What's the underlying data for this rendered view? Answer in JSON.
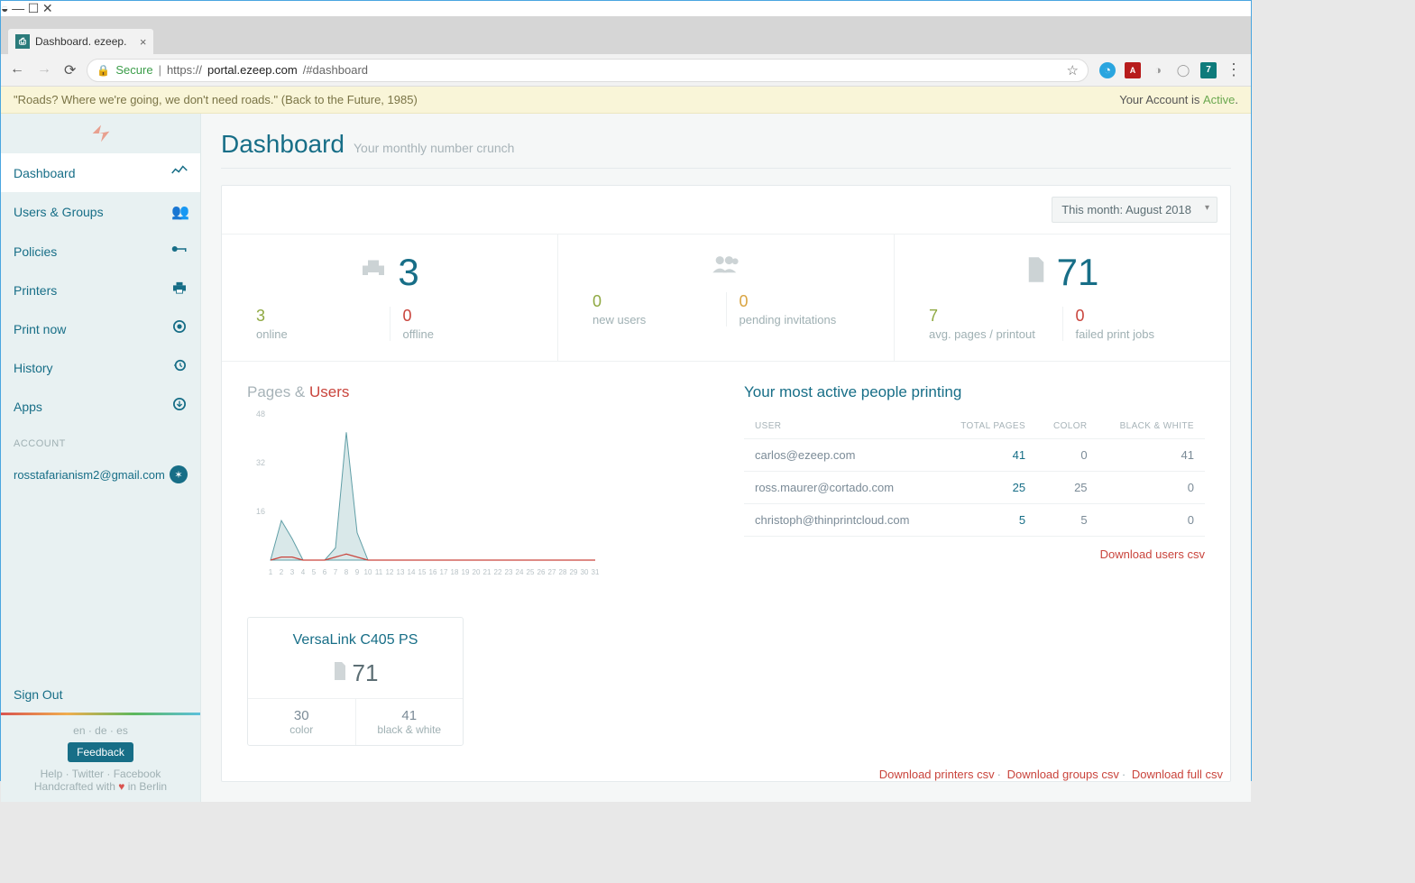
{
  "browser": {
    "tab_title": "Dashboard. ezeep.",
    "secure_label": "Secure",
    "url_scheme": "https://",
    "url_host": "portal.ezeep.com",
    "url_path": "/#dashboard"
  },
  "banner": {
    "quote": "\"Roads? Where we're going, we don't need roads.\" (Back to the Future, 1985)",
    "account_prefix": "Your Account is ",
    "account_status": "Active"
  },
  "sidebar": {
    "items": [
      {
        "label": "Dashboard"
      },
      {
        "label": "Users & Groups"
      },
      {
        "label": "Policies"
      },
      {
        "label": "Printers"
      },
      {
        "label": "Print now"
      },
      {
        "label": "History"
      },
      {
        "label": "Apps"
      }
    ],
    "account_section": "ACCOUNT",
    "account_email": "rosstafarianism2@gmail.com",
    "signout": "Sign Out",
    "langs": "en  ·  de  ·  es",
    "feedback": "Feedback",
    "help_line": "Help  ·  Twitter  ·  Facebook",
    "crafted_pre": "Handcrafted with ",
    "crafted_post": " in Berlin"
  },
  "header": {
    "title": "Dashboard",
    "subtitle": "Your monthly number crunch"
  },
  "month_selector": "This month: August 2018",
  "stats": {
    "printers_total": "3",
    "printers_online": {
      "num": "3",
      "label": "online"
    },
    "printers_offline": {
      "num": "0",
      "label": "offline"
    },
    "new_users": {
      "num": "0",
      "label": "new users"
    },
    "pending": {
      "num": "0",
      "label": "pending invitations"
    },
    "pages_total": "71",
    "avg_pages": {
      "num": "7",
      "label": "avg. pages / printout"
    },
    "failed": {
      "num": "0",
      "label": "failed print jobs"
    }
  },
  "chart_section": {
    "label_pages": "Pages",
    "label_amp": " & ",
    "label_users": "Users"
  },
  "chart_data": {
    "type": "line",
    "x": [
      1,
      2,
      3,
      4,
      5,
      6,
      7,
      8,
      9,
      10,
      11,
      12,
      13,
      14,
      15,
      16,
      17,
      18,
      19,
      20,
      21,
      22,
      23,
      24,
      25,
      26,
      27,
      28,
      29,
      30,
      31
    ],
    "series": [
      {
        "name": "Pages",
        "values": [
          0,
          13,
          7,
          0,
          0,
          0,
          4,
          42,
          9,
          0,
          0,
          0,
          0,
          0,
          0,
          0,
          0,
          0,
          0,
          0,
          0,
          0,
          0,
          0,
          0,
          0,
          0,
          0,
          0,
          0,
          0
        ]
      },
      {
        "name": "Users",
        "values": [
          0,
          1,
          1,
          0,
          0,
          0,
          1,
          2,
          1,
          0,
          0,
          0,
          0,
          0,
          0,
          0,
          0,
          0,
          0,
          0,
          0,
          0,
          0,
          0,
          0,
          0,
          0,
          0,
          0,
          0,
          0
        ]
      }
    ],
    "xlabel": "",
    "ylabel": "",
    "ylim": [
      0,
      48
    ],
    "yticks": [
      16,
      32,
      48
    ]
  },
  "active_people": {
    "title": "Your most active people printing",
    "cols": [
      "USER",
      "TOTAL PAGES",
      "COLOR",
      "BLACK & WHITE"
    ],
    "rows": [
      {
        "user": "carlos@ezeep.com",
        "total": "41",
        "color": "0",
        "bw": "41"
      },
      {
        "user": "ross.maurer@cortado.com",
        "total": "25",
        "color": "25",
        "bw": "0"
      },
      {
        "user": "christoph@thinprintcloud.com",
        "total": "5",
        "color": "5",
        "bw": "0"
      }
    ],
    "download": "Download users csv"
  },
  "printer_card": {
    "name": "VersaLink C405 PS",
    "total": "71",
    "color_n": "30",
    "color_l": "color",
    "bw_n": "41",
    "bw_l": "black & white"
  },
  "bottom_links": {
    "printers": "Download printers csv",
    "groups": "Download groups csv",
    "full": "Download full csv"
  }
}
